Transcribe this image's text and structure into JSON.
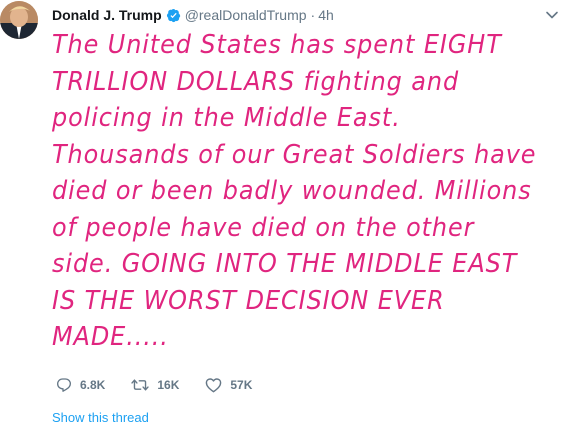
{
  "tweet": {
    "display_name": "Donald J. Trump",
    "handle": "@realDonaldTrump",
    "separator": "·",
    "time": "4h",
    "lines": [
      "The United States has spent EIGHT",
      "TRILLION DOLLARS fighting and",
      "policing in the Middle East.",
      "Thousands of our Great Soldiers have",
      "died or been badly wounded. Millions",
      "of people have died on the other",
      "side. GOING INTO THE MIDDLE EAST",
      "IS THE WORST DECISION EVER",
      "MADE....."
    ],
    "text_color": "#e0257f"
  },
  "actions": {
    "reply_count": "6.8K",
    "retweet_count": "16K",
    "like_count": "57K"
  },
  "show_thread_label": "Show this thread",
  "colors": {
    "verified": "#1da1f2",
    "link": "#1da1f2",
    "muted": "#657786"
  }
}
